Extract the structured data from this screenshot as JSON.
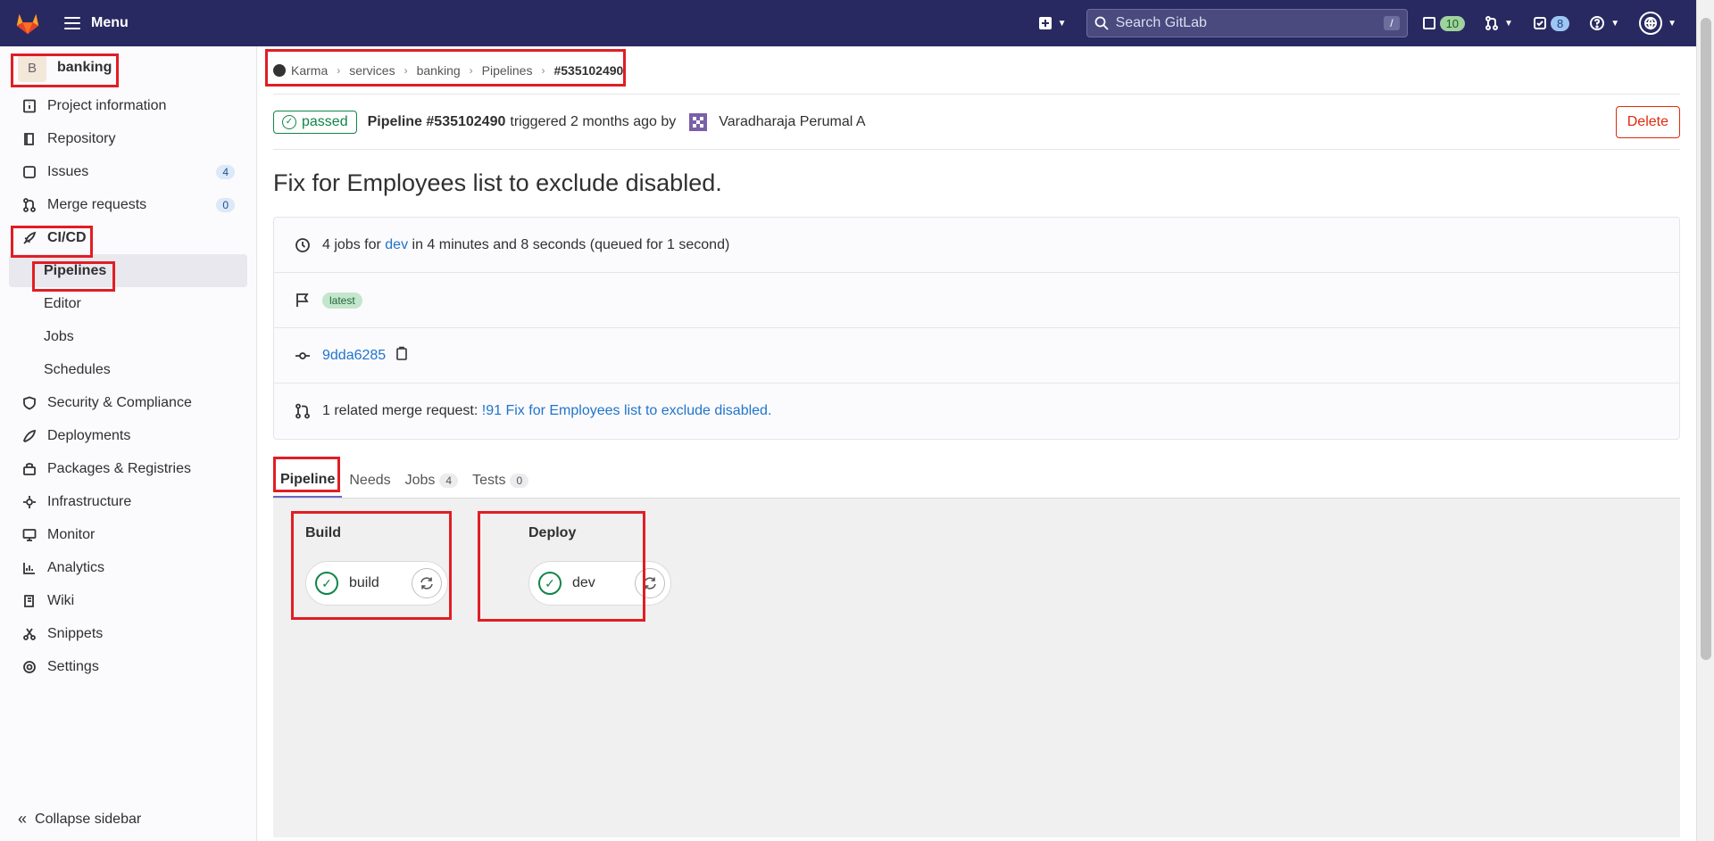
{
  "topbar": {
    "menu_label": "Menu",
    "search_placeholder": "Search GitLab",
    "search_shortcut": "/",
    "issues_count": "10",
    "todos_count": "8"
  },
  "sidebar": {
    "project_initial": "B",
    "project_name": "banking",
    "items": [
      {
        "label": "Project information",
        "icon": "info-icon"
      },
      {
        "label": "Repository",
        "icon": "book-icon"
      },
      {
        "label": "Issues",
        "icon": "issues-icon",
        "badge": "4"
      },
      {
        "label": "Merge requests",
        "icon": "merge-request-icon",
        "badge": "0"
      },
      {
        "label": "CI/CD",
        "icon": "rocket-icon"
      },
      {
        "label": "Security & Compliance",
        "icon": "shield-icon"
      },
      {
        "label": "Deployments",
        "icon": "deployments-icon"
      },
      {
        "label": "Packages & Registries",
        "icon": "package-icon"
      },
      {
        "label": "Infrastructure",
        "icon": "cloud-icon"
      },
      {
        "label": "Monitor",
        "icon": "monitor-icon"
      },
      {
        "label": "Analytics",
        "icon": "chart-icon"
      },
      {
        "label": "Wiki",
        "icon": "wiki-icon"
      },
      {
        "label": "Snippets",
        "icon": "scissors-icon"
      },
      {
        "label": "Settings",
        "icon": "settings-icon"
      }
    ],
    "cicd_sub": [
      "Pipelines",
      "Editor",
      "Jobs",
      "Schedules"
    ],
    "collapse_label": "Collapse sidebar"
  },
  "breadcrumbs": [
    "Karma",
    "services",
    "banking",
    "Pipelines",
    "#535102490"
  ],
  "pipeline": {
    "status": "passed",
    "title": "Pipeline #535102490",
    "triggered": "triggered 2 months ago by",
    "user": "Varadharaja Perumal A",
    "delete_label": "Delete",
    "commit_title": "Fix for Employees list to exclude disabled.",
    "jobs_text_1": "4 jobs for",
    "branch": "dev",
    "jobs_text_2": "in 4 minutes and 8 seconds (queued for 1 second)",
    "tag": "latest",
    "sha": "9dda6285",
    "mr_text": "1 related merge request:",
    "mr_link": "!91 Fix for Employees list to exclude disabled."
  },
  "tabs": [
    {
      "label": "Pipeline"
    },
    {
      "label": "Needs"
    },
    {
      "label": "Jobs",
      "count": "4"
    },
    {
      "label": "Tests",
      "count": "0"
    }
  ],
  "stages": [
    {
      "title": "Build",
      "job": "build"
    },
    {
      "title": "Deploy",
      "job": "dev"
    }
  ]
}
